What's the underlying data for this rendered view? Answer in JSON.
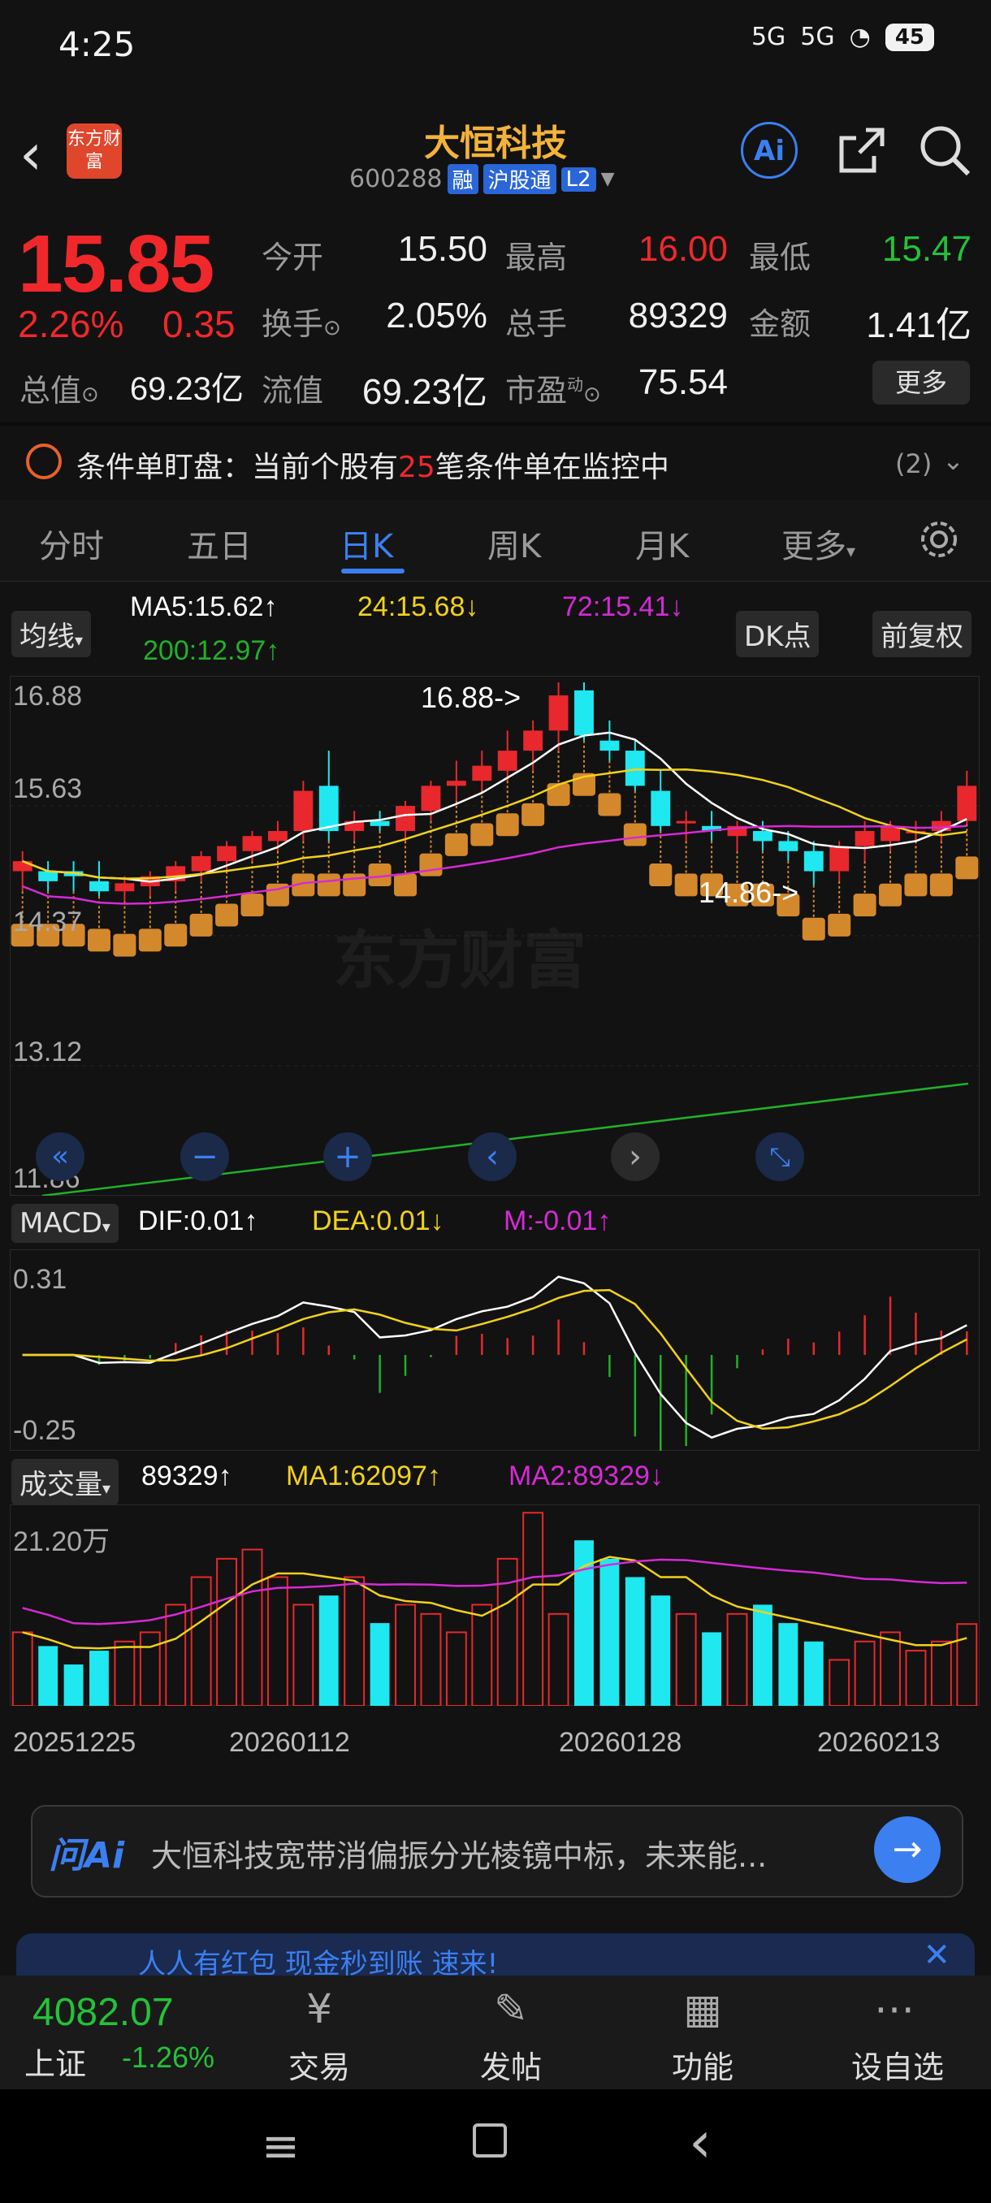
{
  "status": {
    "time": "4:25",
    "signal1": "5G",
    "signal2": "5G",
    "battery": "45"
  },
  "header": {
    "logo_text": "东方财富",
    "stock_name": "大恒科技",
    "stock_code": "600288",
    "tags": [
      "融",
      "沪股通",
      "L2"
    ],
    "ai_label": "Ai"
  },
  "quote": {
    "price": "15.85",
    "change_pct": "2.26%",
    "change_abs": "0.35",
    "open_label": "今开",
    "open": "15.50",
    "high_label": "最高",
    "high": "16.00",
    "low_label": "最低",
    "low": "15.47",
    "turnover_label": "换手",
    "turnover": "2.05%",
    "volume_label": "总手",
    "volume": "89329",
    "amount_label": "金额",
    "amount": "1.41亿",
    "mktcap_label": "总值",
    "mktcap": "69.23亿",
    "float_label": "流值",
    "float": "69.23亿",
    "pe_label": "市盈",
    "pe_sup": "动",
    "pe": "75.54",
    "more": "更多"
  },
  "monitor": {
    "prefix": "条件单盯盘：当前个股有",
    "count": "25",
    "suffix": "笔条件单在监控中",
    "badge": "(2)"
  },
  "tabs": [
    "分时",
    "五日",
    "日K",
    "周K",
    "月K",
    "更多"
  ],
  "active_tab": "日K",
  "kline": {
    "ma_select": "均线",
    "ma5": "MA5:15.62",
    "ma24": "24:15.68",
    "ma72": "72:15.41",
    "ma200": "200:12.97",
    "dk_btn": "DK点",
    "adjust_btn": "前复权",
    "y_ticks": [
      "16.88",
      "15.63",
      "14.37",
      "13.12",
      "11.86"
    ],
    "high_marker": "16.88->",
    "low_marker": "14.86->",
    "watermark": "东方财富",
    "colors": {
      "up": "#e8282c",
      "down": "#1fe8f0",
      "ma5": "#ffffff",
      "ma24": "#f2d21a",
      "ma72": "#d62ad6",
      "ma200": "#22b02a"
    }
  },
  "macd": {
    "select": "MACD",
    "dif": "DIF:0.01",
    "dea": "DEA:0.01",
    "m": "M:-0.01",
    "y_ticks": [
      "0.31",
      "-0.25"
    ]
  },
  "volume": {
    "select": "成交量",
    "value": "89329",
    "ma1": "MA1:62097",
    "ma2": "MA2:89329",
    "y_tick": "21.20万"
  },
  "dates": [
    "20251225",
    "20260112",
    "20260128",
    "20260213"
  ],
  "chart_data": [
    {
      "type": "candlestick",
      "title": "",
      "ylim": [
        11.86,
        16.88
      ],
      "series": [
        {
          "name": "candles",
          "ohlc": [
            [
              15.0,
              15.2,
              14.8,
              15.1
            ],
            [
              15.0,
              15.1,
              14.8,
              14.9
            ],
            [
              15.0,
              15.1,
              14.8,
              14.95
            ],
            [
              14.9,
              15.1,
              14.75,
              14.8
            ],
            [
              14.8,
              14.95,
              14.7,
              14.88
            ],
            [
              14.85,
              15.0,
              14.75,
              14.95
            ],
            [
              14.9,
              15.1,
              14.8,
              15.05
            ],
            [
              15.0,
              15.2,
              14.9,
              15.15
            ],
            [
              15.1,
              15.3,
              15.0,
              15.25
            ],
            [
              15.2,
              15.4,
              15.1,
              15.35
            ],
            [
              15.3,
              15.5,
              15.2,
              15.4
            ],
            [
              15.4,
              15.9,
              15.3,
              15.8
            ],
            [
              15.85,
              16.2,
              15.3,
              15.4
            ],
            [
              15.4,
              15.6,
              15.3,
              15.5
            ],
            [
              15.5,
              15.6,
              15.4,
              15.45
            ],
            [
              15.4,
              15.7,
              15.3,
              15.65
            ],
            [
              15.6,
              15.9,
              15.5,
              15.85
            ],
            [
              15.85,
              16.1,
              15.7,
              15.9
            ],
            [
              15.9,
              16.2,
              15.8,
              16.05
            ],
            [
              16.0,
              16.4,
              15.9,
              16.2
            ],
            [
              16.2,
              16.5,
              16.0,
              16.4
            ],
            [
              16.4,
              16.88,
              16.2,
              16.75
            ],
            [
              16.8,
              16.88,
              16.3,
              16.35
            ],
            [
              16.3,
              16.5,
              16.1,
              16.2
            ],
            [
              16.2,
              16.3,
              15.8,
              15.85
            ],
            [
              15.8,
              16.0,
              15.4,
              15.45
            ],
            [
              15.5,
              15.6,
              15.3,
              15.5
            ],
            [
              15.45,
              15.6,
              15.3,
              15.4
            ],
            [
              15.35,
              15.5,
              15.2,
              15.45
            ],
            [
              15.4,
              15.5,
              15.2,
              15.3
            ],
            [
              15.3,
              15.4,
              15.1,
              15.2
            ],
            [
              15.2,
              15.3,
              14.86,
              15.0
            ],
            [
              15.0,
              15.3,
              14.9,
              15.25
            ],
            [
              15.25,
              15.5,
              15.1,
              15.4
            ],
            [
              15.3,
              15.5,
              15.2,
              15.45
            ],
            [
              15.4,
              15.5,
              15.3,
              15.4
            ],
            [
              15.4,
              15.6,
              15.3,
              15.5
            ],
            [
              15.5,
              16.0,
              15.47,
              15.85
            ]
          ]
        }
      ]
    },
    {
      "type": "bar",
      "title": "",
      "ylim": [
        0,
        21.2
      ],
      "ylabel": "",
      "series": [
        {
          "name": "volume",
          "values": [
            8,
            6.5,
            4.5,
            6,
            7,
            8,
            11,
            14,
            16,
            17,
            14,
            11,
            12,
            14,
            9,
            11,
            10,
            8,
            11,
            16,
            21,
            10,
            18,
            16,
            14,
            12,
            10,
            8,
            10,
            11,
            9,
            7,
            5,
            7,
            8,
            6,
            7,
            8.9
          ]
        }
      ]
    }
  ]
}
